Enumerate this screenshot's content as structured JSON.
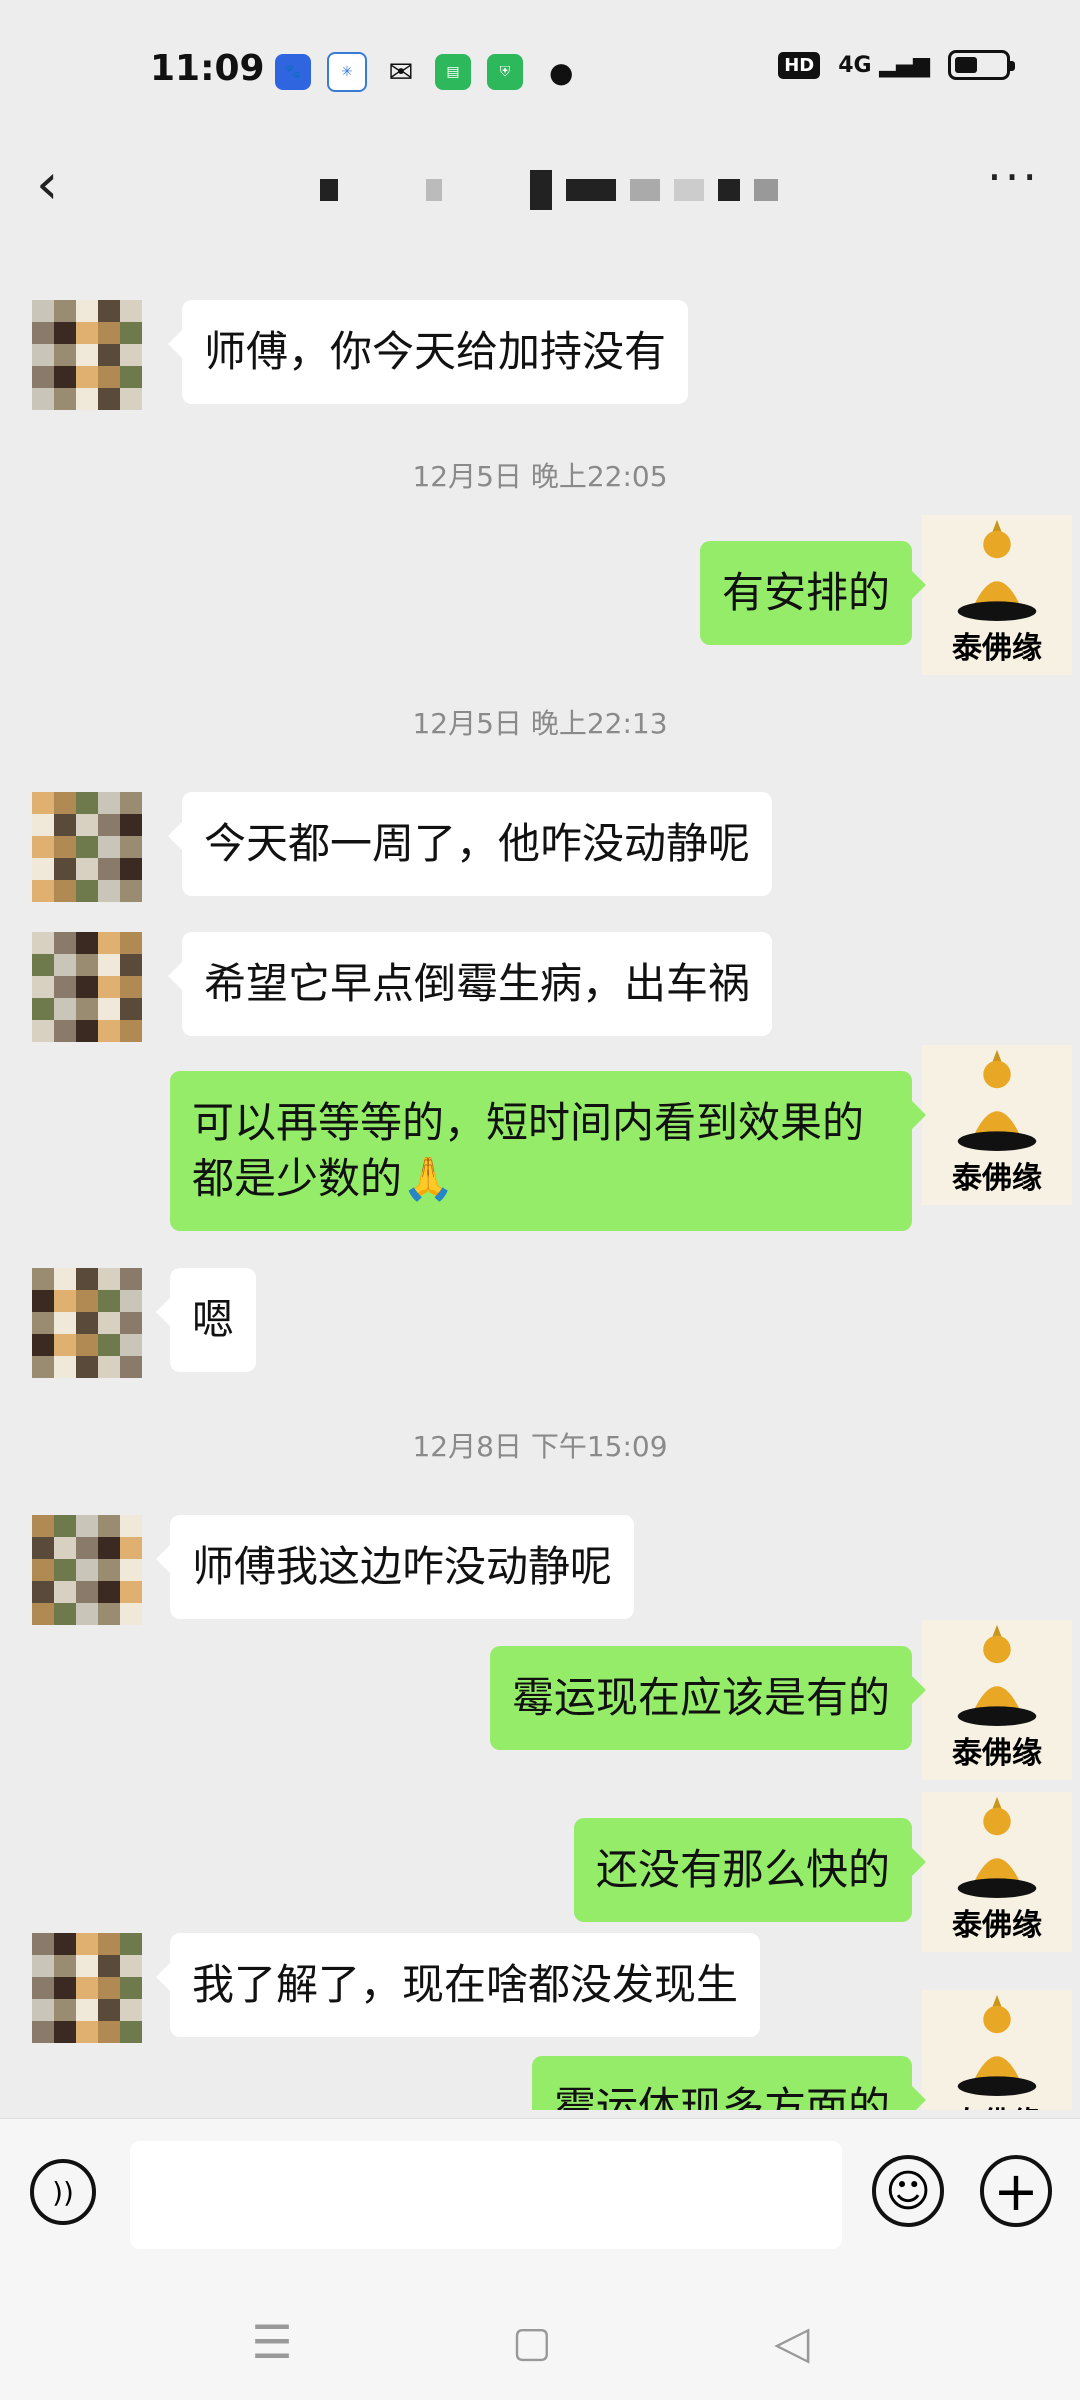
{
  "status_bar": {
    "time": "11:09",
    "network": "4G",
    "hd": "HD",
    "app_icons": [
      "baidu-icon",
      "ifly-icon",
      "wechat-icon",
      "messages-icon",
      "security-icon"
    ]
  },
  "header": {
    "back_icon": "chevron-left-icon",
    "more_icon": "more-dots-icon"
  },
  "contact": {
    "brand": "泰佛缘"
  },
  "messages": [
    {
      "from": "them",
      "text": "师傅，你今天给加持没有"
    },
    {
      "timestamp": "12月5日 晚上22:05"
    },
    {
      "from": "me",
      "text": "有安排的"
    },
    {
      "timestamp": "12月5日 晚上22:13"
    },
    {
      "from": "them",
      "text": "今天都一周了，他咋没动静呢"
    },
    {
      "from": "them",
      "text": "希望它早点倒霉生病，出车祸"
    },
    {
      "from": "me",
      "text": "可以再等等的，短时间内看到效果的都是少数的🙏"
    },
    {
      "from": "them",
      "text": "嗯"
    },
    {
      "timestamp": "12月8日 下午15:09"
    },
    {
      "from": "them",
      "text": "师傅我这边咋没动静呢"
    },
    {
      "from": "me",
      "text": "霉运现在应该是有的"
    },
    {
      "from": "me",
      "text": "还没有那么快的"
    },
    {
      "from": "them",
      "text": "我了解了，现在啥都没发现生"
    },
    {
      "from": "me",
      "text": "霉运体现多方面的"
    }
  ],
  "input": {
    "value": "",
    "voice_icon": "voice-icon",
    "emoji_icon": "emoji-icon",
    "plus_icon": "plus-icon"
  },
  "nav": {
    "menu_icon": "menu-icon",
    "home_icon": "home-icon",
    "back_icon": "nav-back-icon"
  },
  "colors": {
    "outgoing_bubble": "#95ec69",
    "incoming_bubble": "#ffffff",
    "background": "#ededed"
  }
}
